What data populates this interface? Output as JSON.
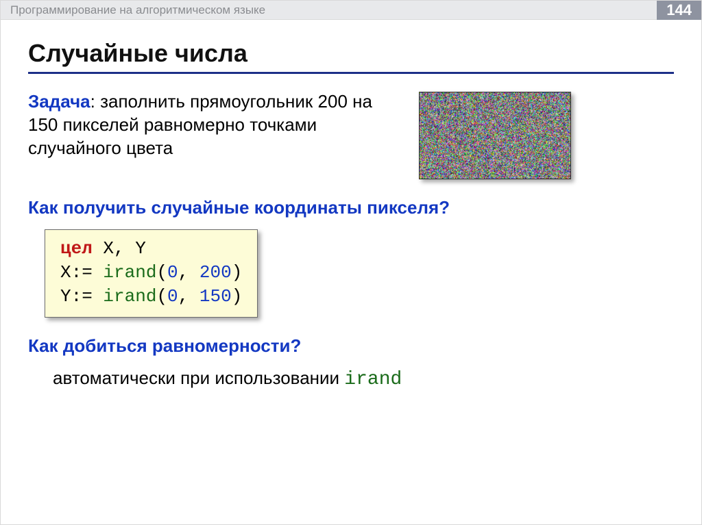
{
  "header": {
    "title": "Программирование на алгоритмическом языке",
    "page_number": "144"
  },
  "slide_title": "Случайные числа",
  "task": {
    "label": "Задача",
    "text": ": заполнить прямоугольник 200 на 150 пикселей равномерно точками случайного цвета"
  },
  "question_coords": "Как получить случайные координаты пикселя?",
  "code": {
    "kw_int": "цел",
    "decl_vars": " X, Y",
    "line2_pre": "X:= ",
    "func2": "irand",
    "line2_args_open": "(",
    "line2_a": "0",
    "line2_sep": ", ",
    "line2_b": "200",
    "line2_close": ")",
    "line3_pre": "Y:= ",
    "func3": "irand",
    "line3_args_open": "(",
    "line3_a": "0",
    "line3_sep": ", ",
    "line3_b": "150",
    "line3_close": ")"
  },
  "question_uniform": "Как добиться равномерности?",
  "answer": {
    "text": "автоматически при использовании ",
    "func": "irand"
  }
}
